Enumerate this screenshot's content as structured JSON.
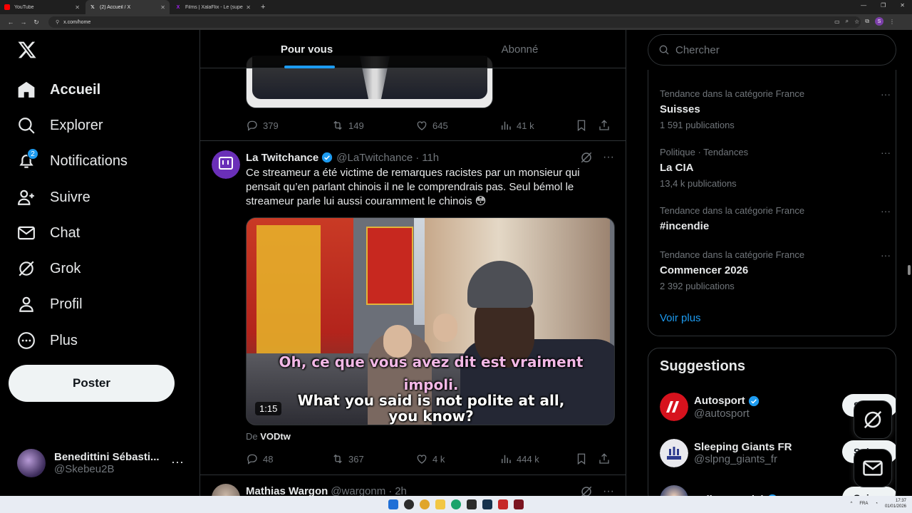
{
  "browser": {
    "tabs": [
      {
        "title": "YouTube",
        "color": "#ff0000"
      },
      {
        "title": "(2) Accueil / X",
        "color": "#ffffff"
      },
      {
        "title": "Films | XalaFlix - Le (super) site",
        "color": "#a020f0"
      }
    ],
    "url": "x.com/home",
    "profile_initial": "S"
  },
  "nav": {
    "items": [
      {
        "label": "Accueil",
        "icon": "home-icon"
      },
      {
        "label": "Explorer",
        "icon": "search-icon"
      },
      {
        "label": "Notifications",
        "icon": "bell-icon",
        "badge": "2"
      },
      {
        "label": "Suivre",
        "icon": "person-plus-icon"
      },
      {
        "label": "Chat",
        "icon": "mail-icon"
      },
      {
        "label": "Grok",
        "icon": "grok-icon"
      },
      {
        "label": "Profil",
        "icon": "person-icon"
      },
      {
        "label": "Plus",
        "icon": "more-circle-icon"
      }
    ],
    "post_button": "Poster",
    "profile": {
      "name": "Benedittini Sébasti...",
      "handle": "@Skebeu2B"
    }
  },
  "feed": {
    "tabs": [
      "Pour vous",
      "Abonné"
    ],
    "prev_tweet_stats": {
      "replies": "379",
      "reposts": "149",
      "likes": "645",
      "views": "41 k"
    },
    "tweet": {
      "name": "La Twitchance",
      "handle": "@LaTwitchance",
      "time": "11h",
      "text": "Ce streameur a été victime de remarques racistes par un monsieur qui pensait qu’en parlant chinois il ne le comprendrais pas. Seul bémol le streameur parle lui aussi couramment le chinois 😳",
      "subtitle_fr_1": "Oh, ce que vous avez dit est vraiment",
      "subtitle_fr_2": "impoli.",
      "subtitle_en_1": "What you said is not polite at all,",
      "subtitle_en_2": "you know?",
      "duration": "1:15",
      "source_prefix": "De",
      "source": "VODtw",
      "stats": {
        "replies": "48",
        "reposts": "367",
        "likes": "4 k",
        "views": "444 k"
      }
    },
    "next_tweet": {
      "name": "Mathias Wargon",
      "handle": "@wargonm",
      "time": "2h"
    }
  },
  "sidebar": {
    "search_placeholder": "Chercher",
    "trends": [
      {
        "category": "Tendance dans la catégorie France",
        "name": "Suisses",
        "count": "1 591 publications"
      },
      {
        "category": "Politique · Tendances",
        "name": "La CIA",
        "count": "13,4 k publications"
      },
      {
        "category": "Tendance dans la catégorie France",
        "name": "#incendie",
        "count": ""
      },
      {
        "category": "Tendance dans la catégorie France",
        "name": "Commencer 2026",
        "count": "2 392 publications"
      }
    ],
    "see_more": "Voir plus",
    "suggestions_title": "Suggestions",
    "suggestions": [
      {
        "name": "Autosport",
        "handle": "@autosport",
        "button": "Suivre",
        "verified": true
      },
      {
        "name": "Sleeping Giants FR",
        "handle": "@slpng_giants_fr",
        "button": "Suivre",
        "verified": false
      },
      {
        "name": "Julien Pernici",
        "handle": "",
        "button": "Suivre",
        "verified": true
      }
    ]
  },
  "taskbar": {
    "lang": "FRA",
    "time": "17:37",
    "date": "01/01/2026"
  },
  "colors": {
    "accent": "#1d9bf0",
    "background": "#000000",
    "border": "#2f3336",
    "muted": "#71767b"
  }
}
